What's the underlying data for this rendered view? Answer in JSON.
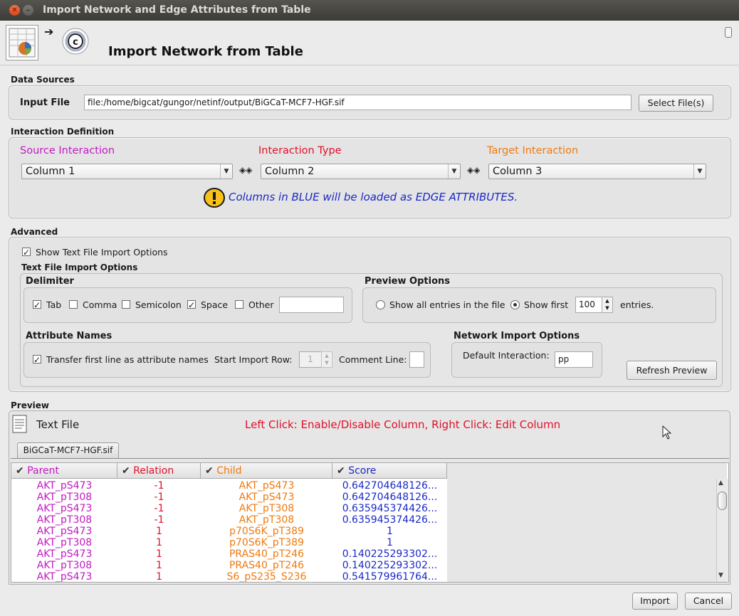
{
  "window": {
    "title": "Import Network and Edge Attributes from Table"
  },
  "header": {
    "title": "Import Network from Table"
  },
  "data_sources": {
    "section_label": "Data Sources",
    "input_file_label": "Input File",
    "input_file_value": "file:/home/bigcat/gungor/netinf/output/BiGCaT-MCF7-HGF.sif",
    "select_button": "Select File(s)"
  },
  "interaction": {
    "section_label": "Interaction Definition",
    "source_label": "Source Interaction",
    "type_label": "Interaction Type",
    "target_label": "Target Interaction",
    "source_value": "Column 1",
    "type_value": "Column 2",
    "target_value": "Column 3",
    "warning": "Columns in BLUE will be loaded as EDGE ATTRIBUTES.",
    "colors": {
      "source": "#c11ac1",
      "type": "#e0102a",
      "target": "#ee7a10",
      "warning": "#1a28c8"
    }
  },
  "advanced": {
    "section_label": "Advanced",
    "show_text_options_label": "Show Text File Import Options",
    "show_text_options_checked": true,
    "text_options_label": "Text File Import Options",
    "delimiter": {
      "label": "Delimiter",
      "options": [
        {
          "label": "Tab",
          "checked": true
        },
        {
          "label": "Comma",
          "checked": false
        },
        {
          "label": "Semicolon",
          "checked": false
        },
        {
          "label": "Space",
          "checked": true
        },
        {
          "label": "Other",
          "checked": false
        }
      ],
      "other_value": ""
    },
    "preview_options": {
      "label": "Preview Options",
      "show_all_label": "Show all entries in the file",
      "show_first_label": "Show first",
      "show_first_value": "100",
      "entries_label": "entries.",
      "selected": "show_first"
    },
    "attribute_names": {
      "label": "Attribute Names",
      "transfer_label": "Transfer first line as attribute names",
      "transfer_checked": true,
      "start_row_label": "Start Import Row:",
      "start_row_value": "1",
      "comment_line_label": "Comment Line:",
      "comment_line_value": ""
    },
    "network_import": {
      "label": "Network Import Options",
      "default_interaction_label": "Default Interaction:",
      "default_interaction_value": "pp"
    },
    "refresh_button": "Refresh Preview"
  },
  "preview": {
    "section_label": "Preview",
    "text_file_label": "Text File",
    "hint": "Left Click: Enable/Disable Column, Right Click: Edit Column",
    "tab_label": "BiGCaT-MCF7-HGF.sif",
    "columns": [
      "Parent",
      "Relation",
      "Child",
      "Score"
    ],
    "rows": [
      [
        "AKT_pS473",
        "-1",
        "AKT_pS473",
        "0.642704648126..."
      ],
      [
        "AKT_pT308",
        "-1",
        "AKT_pS473",
        "0.642704648126..."
      ],
      [
        "AKT_pS473",
        "-1",
        "AKT_pT308",
        "0.635945374426..."
      ],
      [
        "AKT_pT308",
        "-1",
        "AKT_pT308",
        "0.635945374426..."
      ],
      [
        "AKT_pS473",
        "1",
        "p70S6K_pT389",
        "1"
      ],
      [
        "AKT_pT308",
        "1",
        "p70S6K_pT389",
        "1"
      ],
      [
        "AKT_pS473",
        "1",
        "PRAS40_pT246",
        "0.140225293302..."
      ],
      [
        "AKT_pT308",
        "1",
        "PRAS40_pT246",
        "0.140225293302..."
      ],
      [
        "AKT_pS473",
        "1",
        "S6_pS235_S236",
        "0.541579961764..."
      ]
    ]
  },
  "footer": {
    "import_button": "Import",
    "cancel_button": "Cancel"
  }
}
